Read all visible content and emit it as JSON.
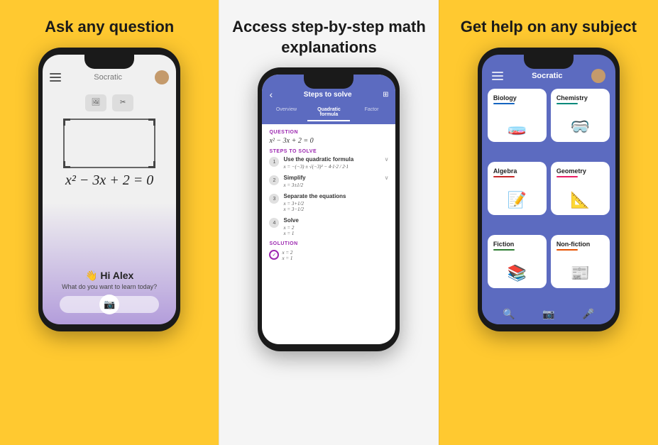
{
  "panel1": {
    "title": "Ask any question",
    "header_title": "Socratic",
    "equation": "x² − 3x + 2 = 0",
    "greeting": "👋 Hi Alex",
    "sub": "What do you want to learn today?"
  },
  "panel2": {
    "title": "Access step-by-step math explanations",
    "header_title": "Steps to solve",
    "tabs": [
      "Overview",
      "Quadratic formula",
      "Factor"
    ],
    "question_label": "QUESTION",
    "question": "x² − 3x + 2 = 0",
    "steps_label": "STEPS TO SOLVE",
    "steps": [
      {
        "num": "1",
        "title": "Use the quadratic formula",
        "formula": "x = −(−3) ± √(−3)² − 4·1·2 / 2·1"
      },
      {
        "num": "2",
        "title": "Simplify",
        "formula": "x = 3±1/2"
      },
      {
        "num": "3",
        "title": "Separate the equations",
        "formula": "x = 3+1/2\nx = 3−1/2"
      },
      {
        "num": "4",
        "title": "Solve",
        "formula": "x = 2\nx = 1"
      }
    ],
    "solution_label": "SOLUTION",
    "solution": "x = 2\nx = 1"
  },
  "panel3": {
    "title": "Get help on any subject",
    "header_title": "Socratic",
    "subjects": [
      {
        "name": "Biology",
        "emoji": "🧫",
        "line": "line-blue"
      },
      {
        "name": "Chemistry",
        "emoji": "🥽",
        "line": "line-teal"
      },
      {
        "name": "Algebra",
        "emoji": "📝",
        "line": "line-red"
      },
      {
        "name": "Geometry",
        "emoji": "📐",
        "line": "line-pink"
      },
      {
        "name": "Fiction",
        "emoji": "📚",
        "line": "line-green"
      },
      {
        "name": "Non-fiction",
        "emoji": "📰",
        "line": "line-orange"
      }
    ]
  }
}
